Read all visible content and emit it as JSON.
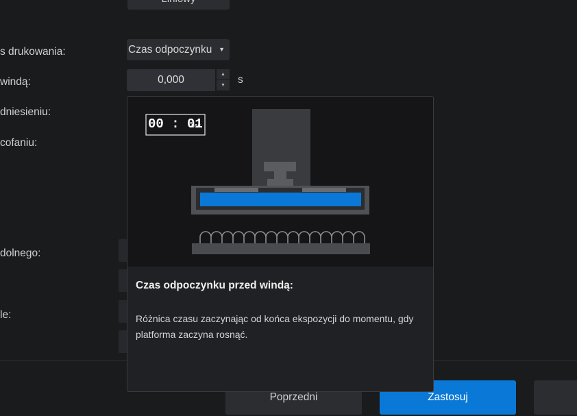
{
  "top_button": {
    "label": "Liniowy"
  },
  "labels": {
    "print_mode": "s drukowania:",
    "rest_before_lift": "windą:",
    "after_lift": "dniesieniu:",
    "after_retract": "cofaniu:",
    "bottom": "dolnego:",
    "other": "le:"
  },
  "print_mode_select": {
    "value": "Czas odpoczynku"
  },
  "rest_time_input": {
    "value": "0,000",
    "unit": "s"
  },
  "tooltip": {
    "timer": {
      "time": "00 : 01",
      "unit": "sec"
    },
    "title": "Czas odpoczynku przed windą:",
    "description": "Różnica czasu zaczynając od końca ekspozycji do momentu, gdy platforma zaczyna rosnąć."
  },
  "footer": {
    "prev_label": "Poprzedni",
    "apply_label": "Zastosuj"
  },
  "colors": {
    "accent": "#0a78d7",
    "resin": "#0a78d7",
    "background": "#1a1b1d"
  }
}
